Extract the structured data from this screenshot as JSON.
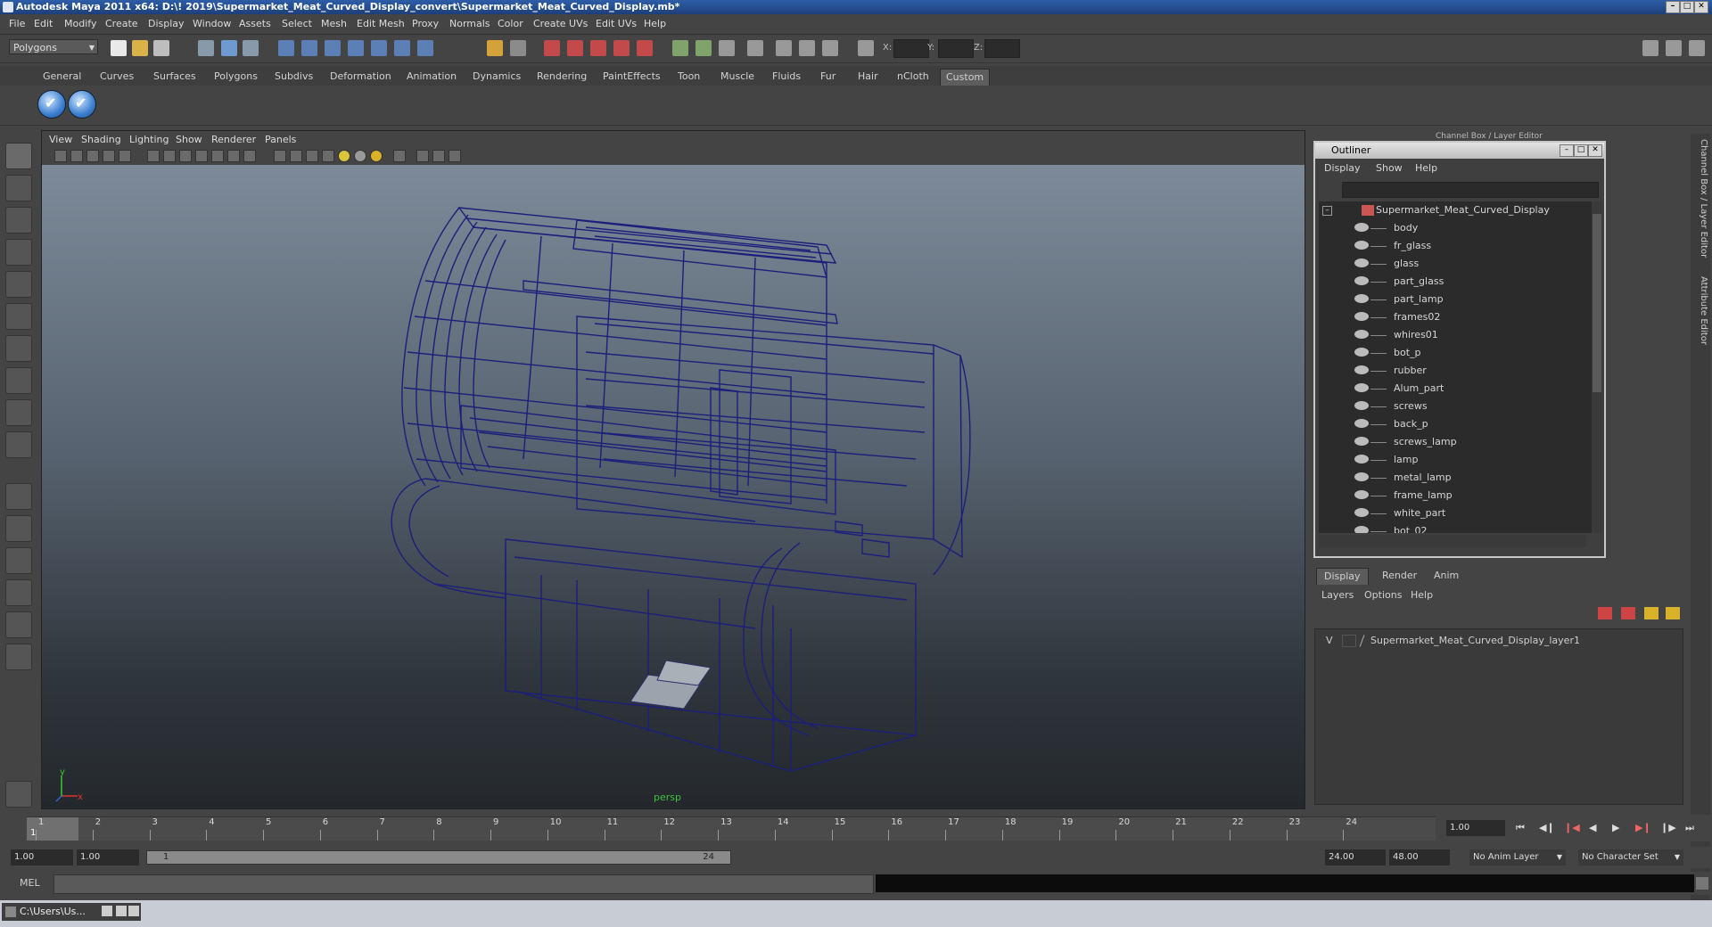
{
  "window": {
    "title": "Autodesk Maya 2011 x64: D:\\! 2019\\Supermarket_Meat_Curved_Display_convert\\Supermarket_Meat_Curved_Display.mb*"
  },
  "menu": [
    "File",
    "Edit",
    "Modify",
    "Create",
    "Display",
    "Window",
    "Assets",
    "Select",
    "Mesh",
    "Edit Mesh",
    "Proxy",
    "Normals",
    "Color",
    "Create UVs",
    "Edit UVs",
    "Help"
  ],
  "status_line": {
    "mode": "Polygons",
    "x_label": "X:",
    "y_label": "Y:",
    "z_label": "Z:"
  },
  "shelf": {
    "tabs": [
      "General",
      "Curves",
      "Surfaces",
      "Polygons",
      "Subdivs",
      "Deformation",
      "Animation",
      "Dynamics",
      "Rendering",
      "PaintEffects",
      "Toon",
      "Muscle",
      "Fluids",
      "Fur",
      "Hair",
      "nCloth",
      "Custom"
    ],
    "active_tab": "Custom"
  },
  "viewport": {
    "menu": [
      "View",
      "Shading",
      "Lighting",
      "Show",
      "Renderer",
      "Panels"
    ],
    "camera": "persp",
    "wire_color": "#1b1f7a"
  },
  "channel_box": {
    "title": "Channel Box / Layer Editor"
  },
  "side_tabs": [
    "Channel Box / Layer Editor",
    "Attribute Editor"
  ],
  "outliner": {
    "title": "Outliner",
    "menu": [
      "Display",
      "Show",
      "Help"
    ],
    "root": "Supermarket_Meat_Curved_Display",
    "items": [
      "body",
      "fr_glass",
      "glass",
      "part_glass",
      "part_lamp",
      "frames02",
      "whires01",
      "bot_p",
      "rubber",
      "Alum_part",
      "screws",
      "back_p",
      "screws_lamp",
      "lamp",
      "metal_lamp",
      "frame_lamp",
      "white_part",
      "bot_02"
    ]
  },
  "layer_editor": {
    "tabs": [
      "Display",
      "Render",
      "Anim"
    ],
    "active_tab": "Display",
    "menu": [
      "Layers",
      "Options",
      "Help"
    ],
    "layers": [
      {
        "visible": "V",
        "name": "Supermarket_Meat_Curved_Display_layer1"
      }
    ]
  },
  "time_slider": {
    "ticks": [
      "1",
      "2",
      "3",
      "4",
      "5",
      "6",
      "7",
      "8",
      "9",
      "10",
      "11",
      "12",
      "13",
      "14",
      "15",
      "16",
      "17",
      "18",
      "19",
      "20",
      "21",
      "22",
      "23",
      "24"
    ],
    "current_marker": "1",
    "current_frame": "1.00"
  },
  "range_slider": {
    "start": "1.00",
    "playback_start": "1.00",
    "bar_start": "1",
    "bar_end": "24",
    "playback_end": "24.00",
    "end": "48.00",
    "anim_layer": "No Anim Layer",
    "character_set": "No Character Set"
  },
  "command_line": {
    "label": "MEL"
  },
  "taskbar": {
    "item": "C:\\Users\\Us..."
  }
}
